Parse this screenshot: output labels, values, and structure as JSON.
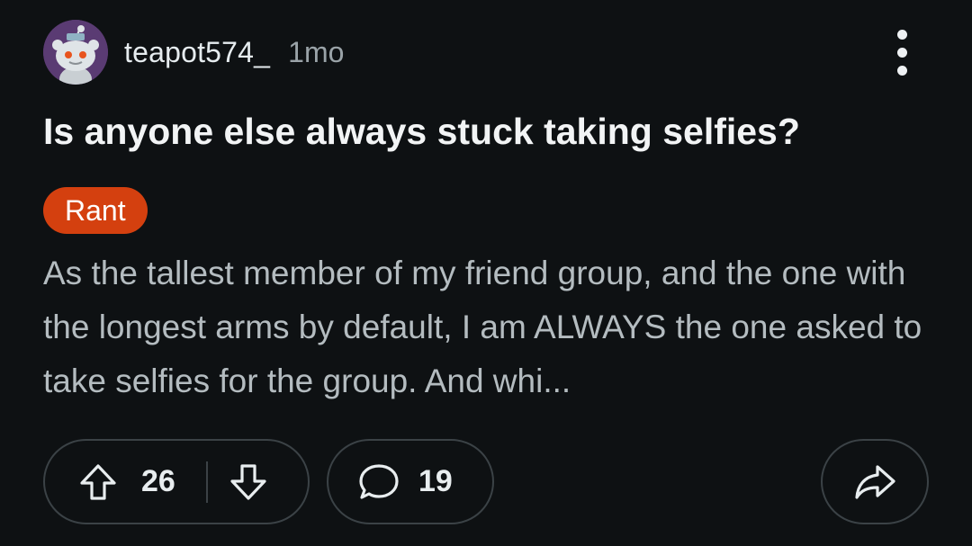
{
  "post": {
    "author": "teapot574_",
    "age": "1mo",
    "title": "Is anyone else always stuck taking selfies?",
    "flair": "Rant",
    "body": "As the tallest member of my friend group, and the one with the longest arms by default, I am ALWAYS the one asked to take selfies for the group. And whi...",
    "upvotes": "26",
    "comments": "19"
  },
  "icons": {
    "avatar": "snoo-avatar",
    "menu": "overflow-menu-icon",
    "upvote": "arrow-up-icon",
    "downvote": "arrow-down-icon",
    "comment": "speech-bubble-icon",
    "share": "share-arrow-icon"
  },
  "colors": {
    "background": "#0e1113",
    "flair": "#d4400f",
    "title": "#f2f4f5",
    "body": "#b4bcc0",
    "muted": "#9aa3a8",
    "pill_border": "#3b4246"
  }
}
